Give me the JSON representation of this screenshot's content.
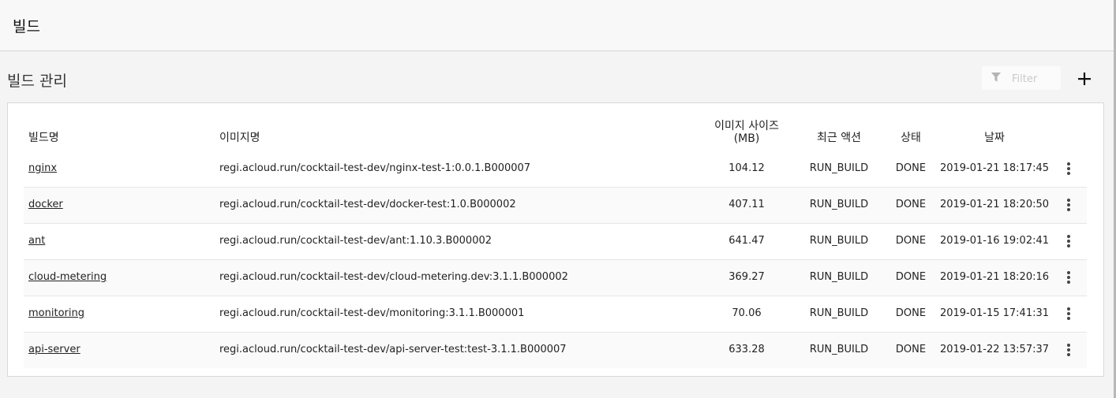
{
  "header": {
    "title": "빌드"
  },
  "section": {
    "title": "빌드 관리"
  },
  "filter": {
    "placeholder": "Filter"
  },
  "table": {
    "columns": {
      "name": "빌드명",
      "image": "이미지명",
      "size_line1": "이미지 사이즈",
      "size_line2": "(MB)",
      "action": "최근 액션",
      "status": "상태",
      "date": "날짜"
    },
    "rows": [
      {
        "name": "nginx",
        "image": "regi.acloud.run/cocktail-test-dev/nginx-test-1:0.0.1.B000007",
        "size": "104.12",
        "action": "RUN_BUILD",
        "status": "DONE",
        "date": "2019-01-21 18:17:45"
      },
      {
        "name": "docker",
        "image": "regi.acloud.run/cocktail-test-dev/docker-test:1.0.B000002",
        "size": "407.11",
        "action": "RUN_BUILD",
        "status": "DONE",
        "date": "2019-01-21 18:20:50"
      },
      {
        "name": "ant",
        "image": "regi.acloud.run/cocktail-test-dev/ant:1.10.3.B000002",
        "size": "641.47",
        "action": "RUN_BUILD",
        "status": "DONE",
        "date": "2019-01-16 19:02:41"
      },
      {
        "name": "cloud-metering",
        "image": "regi.acloud.run/cocktail-test-dev/cloud-metering.dev:3.1.1.B000002",
        "size": "369.27",
        "action": "RUN_BUILD",
        "status": "DONE",
        "date": "2019-01-21 18:20:16"
      },
      {
        "name": "monitoring",
        "image": "regi.acloud.run/cocktail-test-dev/monitoring:3.1.1.B000001",
        "size": "70.06",
        "action": "RUN_BUILD",
        "status": "DONE",
        "date": "2019-01-15 17:41:31"
      },
      {
        "name": "api-server",
        "image": "regi.acloud.run/cocktail-test-dev/api-server-test:test-3.1.1.B000007",
        "size": "633.28",
        "action": "RUN_BUILD",
        "status": "DONE",
        "date": "2019-01-22 13:57:37"
      }
    ]
  }
}
